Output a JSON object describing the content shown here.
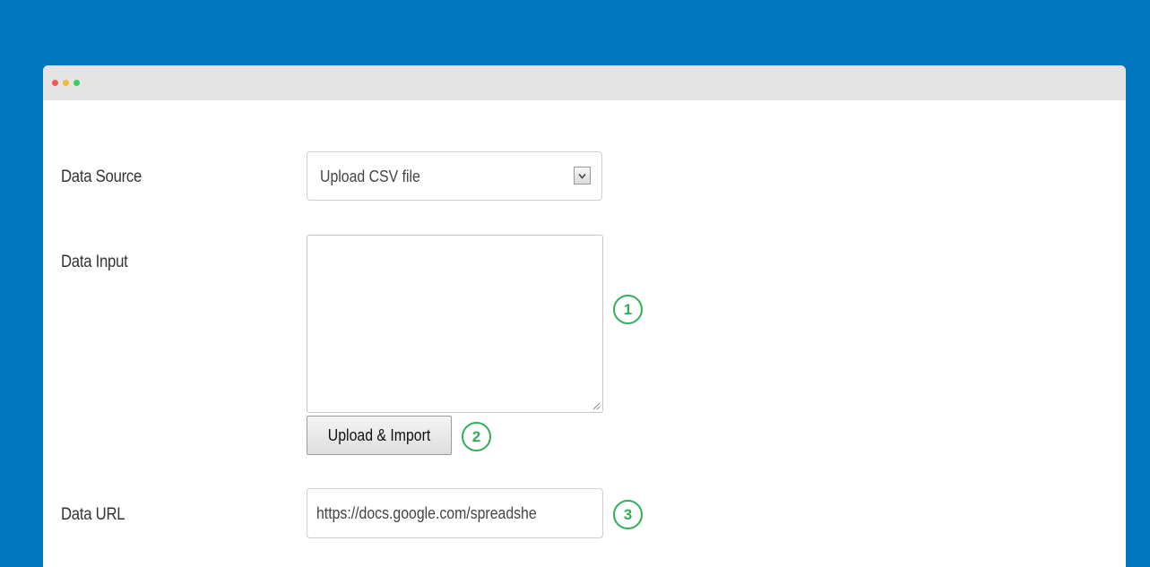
{
  "window": {
    "controls": [
      "close-dot",
      "minimize-dot",
      "maximize-dot"
    ]
  },
  "form": {
    "data_source": {
      "label": "Data Source",
      "selected": "Upload CSV file"
    },
    "data_input": {
      "label": "Data Input",
      "value": "",
      "badge": "1"
    },
    "upload_button": {
      "label": "Upload & Import",
      "badge": "2"
    },
    "data_url": {
      "label": "Data URL",
      "value": "https://docs.google.com/spreadshe",
      "badge": "3"
    }
  },
  "colors": {
    "background": "#0076be",
    "badge": "#2fae58"
  }
}
